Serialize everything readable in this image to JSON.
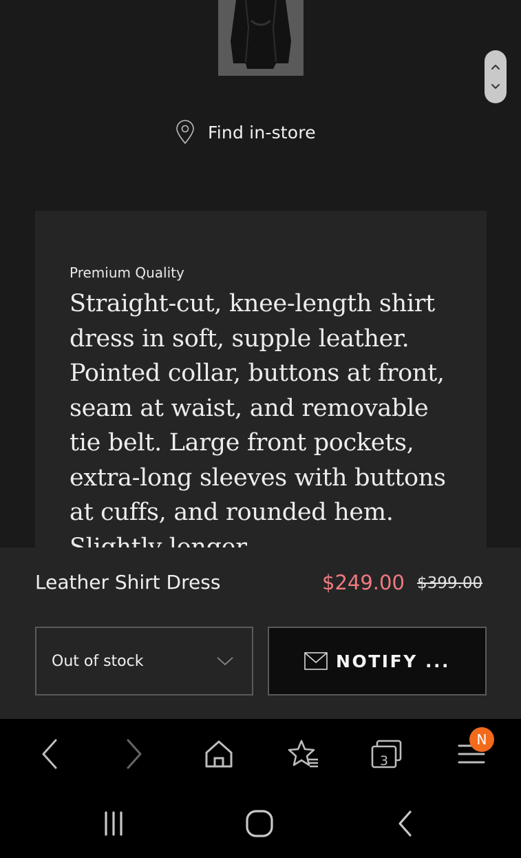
{
  "product": {
    "thumbnail_alt": "",
    "find_store_label": "Find in-store",
    "description_eyebrow": "Premium Quality",
    "description": "Straight-cut, knee-length shirt dress in soft, supple leather. Pointed collar, buttons at front, seam at waist, and removable tie belt. Large front pockets, extra-long sleeves with buttons at cuffs, and rounded hem. Slightly longer",
    "name": "Leather Shirt Dress",
    "price_current": "$249.00",
    "price_original": "$399.00",
    "size_select_value": "Out of stock",
    "notify_label": "NOTIFY ..."
  },
  "browser": {
    "tabs_count": "3",
    "menu_badge": "N"
  },
  "colors": {
    "sale_price": "#f07a80",
    "badge": "#f26a1b"
  },
  "icons": {
    "scroll_up": "chevron-up-icon",
    "scroll_down": "chevron-down-icon",
    "find_store": "location-pin-icon",
    "select_caret": "chevron-down-icon",
    "notify": "envelope-icon",
    "back": "chevron-left-icon",
    "forward": "chevron-right-icon",
    "home": "home-icon",
    "bookmarks": "star-list-icon",
    "tabs": "tabs-icon",
    "menu": "hamburger-icon",
    "recent_apps": "recent-apps-icon",
    "nav_home": "circle-home-icon",
    "nav_back": "nav-back-icon"
  }
}
